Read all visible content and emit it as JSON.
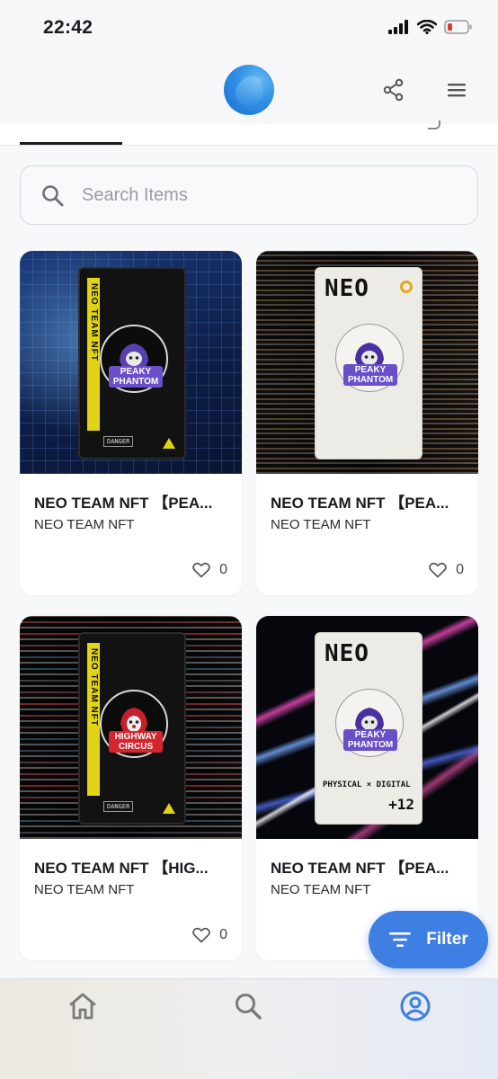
{
  "status_bar": {
    "time": "22:42"
  },
  "search": {
    "placeholder": "Search Items"
  },
  "items": [
    {
      "title": "NEO TEAM NFT 【PEA...",
      "subtitle": "NEO TEAM NFT",
      "likes": "0",
      "art": {
        "side_text": "NEO TEAM NFT",
        "badge_text": "PEAKY PHANTOM",
        "footer": "DANGER"
      }
    },
    {
      "title": "NEO TEAM NFT 【PEA...",
      "subtitle": "NEO TEAM NFT",
      "likes": "0",
      "art": {
        "head": "NEO",
        "badge_text": "PEAKY PHANTOM"
      }
    },
    {
      "title": "NEO TEAM NFT 【HIG...",
      "subtitle": "NEO TEAM NFT",
      "likes": "0",
      "art": {
        "side_text": "NEO TEAM NFT",
        "badge_text": "HIGHWAY CIRCUS",
        "footer": "DANGER"
      }
    },
    {
      "title": "NEO TEAM NFT 【PEA...",
      "subtitle": "NEO TEAM NFT",
      "likes": "",
      "art": {
        "head": "NEO",
        "badge_text": "PEAKY PHANTOM",
        "footer": "PHYSICAL × DIGITAL",
        "extra": "+12"
      }
    }
  ],
  "filter": {
    "label": "Filter"
  },
  "nav": {
    "items": [
      "home-icon",
      "search-icon",
      "profile-icon"
    ],
    "active": "profile-icon"
  },
  "colors": {
    "accent": "#3d7fe3",
    "nav_inactive": "#7a7a7a",
    "text_primary": "#1b1b1f"
  }
}
